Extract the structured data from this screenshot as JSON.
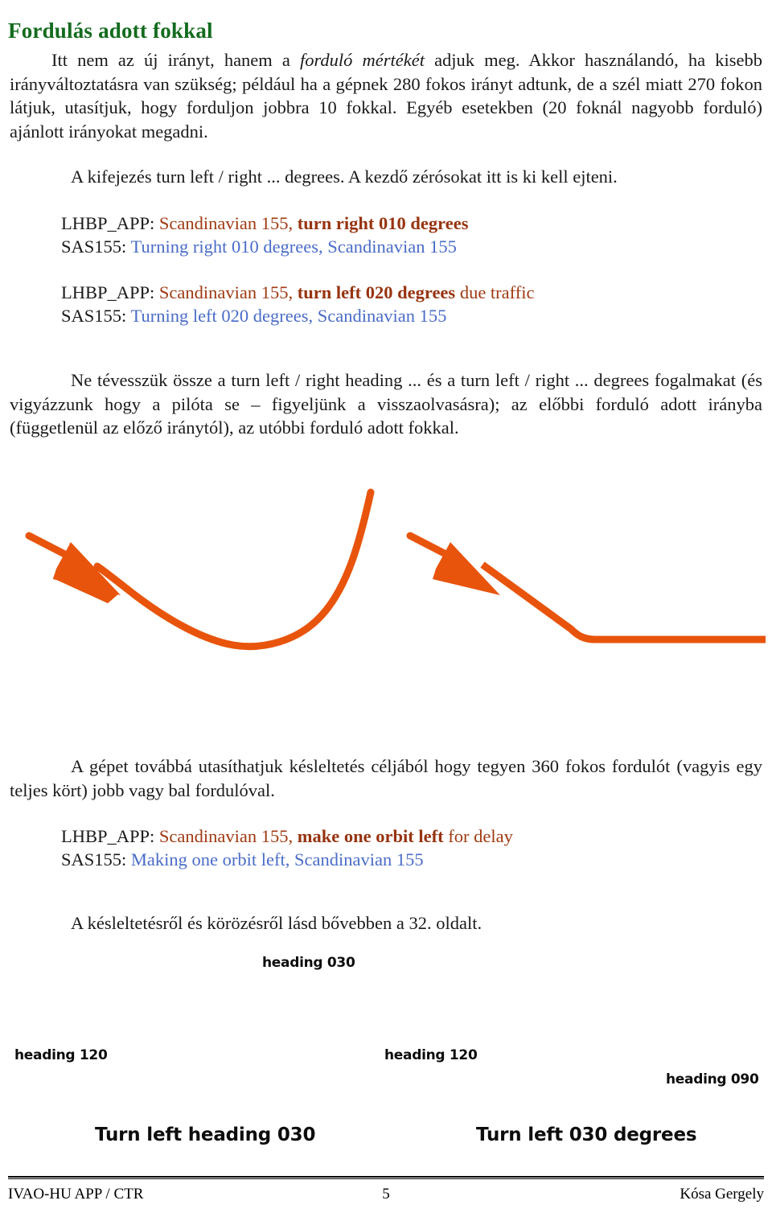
{
  "page": {
    "title": "Fordulás adott fokkal",
    "title_color": "#136B1E",
    "background": "#ffffff"
  },
  "colors": {
    "heading_green": "#136B1E",
    "atc_rust": "#A03A12",
    "atc_rust_bold": "#973310",
    "pilot_blue": "#4A6CC8",
    "diagram_orange": "#E8540C",
    "body_text": "#1a1a1a"
  },
  "paragraphs": {
    "intro_1": "Itt nem az új irányt, hanem a ",
    "intro_1_italic": "forduló mértékét",
    "intro_2": " adjuk meg. Akkor használandó, ha kisebb irányváltoztatásra van szükség; például ha a gépnek 280 fokos irányt adtunk, de a szél miatt 270 fokon látjuk, utasítjuk, hogy forduljon jobbra 10 fokkal. Egyéb esetekben (20 foknál nagyobb forduló) ajánlott irányokat megadni.",
    "kifejezes": "A kifejezés turn left / right ... degrees. A kezdő zérósokat itt is ki kell ejteni.",
    "ne_tevesszuk": "Ne tévesszük össze a turn left / right heading ... és a turn left / right ... degrees fogalmakat (és vigyázzunk hogy a pilóta se – figyeljünk a visszaolvasásra); az előbbi forduló adott irányba (függetlenül az előző iránytól), az utóbbi forduló adott fokkal.",
    "gepet": "A gépet továbbá utasíthatjuk késleltetés céljából hogy tegyen 360 fokos fordulót (vagyis egy teljes kört) jobb vagy bal fordulóval.",
    "kesleltetes": "A késleltetésről és körözésről lásd bővebben a 32. oldalt."
  },
  "radio_exchanges": [
    {
      "id": "turn-right-010",
      "atc_prefix": "LHBP_APP: ",
      "atc_plain_1": "Scandinavian 155, ",
      "atc_bold": "turn right 010 degrees",
      "atc_plain_2": "",
      "pilot_prefix": "SAS155: ",
      "pilot_text": "Turning right 010 degrees, Scandinavian 155"
    },
    {
      "id": "turn-left-020",
      "atc_prefix": "LHBP_APP: ",
      "atc_plain_1": "Scandinavian 155, ",
      "atc_bold": "turn left 020 degrees",
      "atc_plain_2": " due traffic",
      "pilot_prefix": "SAS155: ",
      "pilot_text": "Turning left 020 degrees, Scandinavian 155"
    },
    {
      "id": "make-one-orbit-left",
      "atc_prefix": "LHBP_APP: ",
      "atc_plain_1": "Scandinavian 155, ",
      "atc_bold": "make one orbit left",
      "atc_plain_2": " for delay",
      "pilot_prefix": "SAS155: ",
      "pilot_text": "Making one orbit left, Scandinavian 155"
    }
  ],
  "figure": {
    "left_diagram": {
      "start_label": "heading 030",
      "end_label": "heading 120",
      "caption": "Turn left heading 030"
    },
    "right_diagram": {
      "start_label": "heading 090",
      "end_label": "heading 120",
      "caption": "Turn left 030 degrees"
    }
  },
  "footer": {
    "left": "IVAO-HU APP / CTR",
    "page_number": "5",
    "right": "Kósa Gergely"
  }
}
